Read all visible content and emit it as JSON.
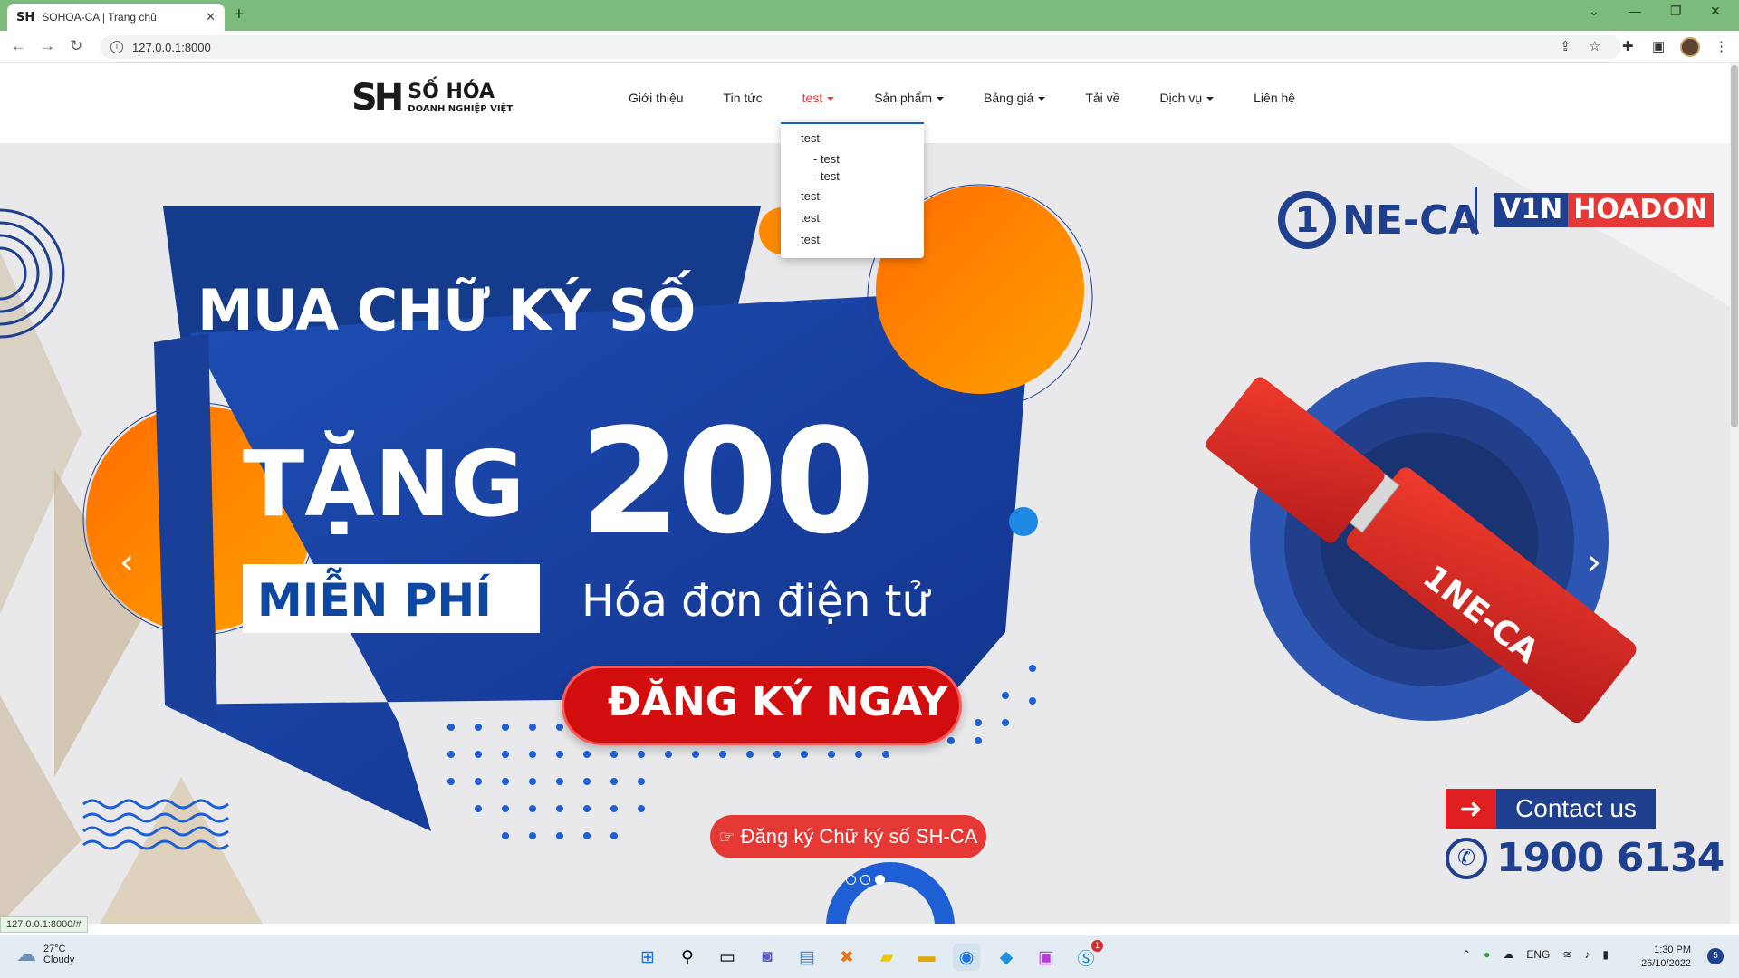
{
  "browser": {
    "tab_title": "SOHOA-CA | Trang chủ",
    "favicon": "SH",
    "new_tab": "+",
    "close": "✕",
    "url": "127.0.0.1:8000",
    "status_url": "127.0.0.1:8000/#"
  },
  "logo": {
    "mark": "SH",
    "title": "SỐ HÓA",
    "subtitle": "DOANH NGHIỆP VIỆT"
  },
  "nav": {
    "items": [
      {
        "label": "Giới thiệu"
      },
      {
        "label": "Tin tức"
      },
      {
        "label": "test"
      },
      {
        "label": "Sản phẩm"
      },
      {
        "label": "Bảng giá"
      },
      {
        "label": "Tải về"
      },
      {
        "label": "Dịch vụ"
      },
      {
        "label": "Liên hệ"
      }
    ],
    "active_color": "#e53935"
  },
  "dropdown": {
    "items": [
      {
        "label": "test"
      },
      {
        "label": "- test"
      },
      {
        "label": "- test"
      },
      {
        "label": "test"
      },
      {
        "label": "test"
      },
      {
        "label": "test"
      }
    ]
  },
  "banner": {
    "headline_1": "MUA CHỮ KÝ SỐ",
    "headline_2": "TẶNG",
    "headline_number": "200",
    "free_label": "MIỄN PHÍ",
    "invoice_label": "Hóa đơn điện tử",
    "register_label": "ĐĂNG KÝ NGAY",
    "brand_one": "NE-CA",
    "brand_one_digit": "1",
    "brand_vin": "V1N",
    "brand_hoadon": "HOADON",
    "usb_brand": "NE-CA",
    "contact_label": "Contact us",
    "hotline": "1900 6134",
    "cta_label": "Đăng ký Chữ ký số SH-CA",
    "brand_blue": "#1f3f8f",
    "brand_red": "#e02020"
  },
  "carousel": {
    "prev_icon": "‹",
    "next_icon": "›",
    "active_index": 2
  },
  "taskbar": {
    "temperature": "27°C",
    "condition": "Cloudy",
    "language": "ENG",
    "time": "1:30 PM",
    "date": "26/10/2022",
    "notification_count": "5",
    "badge_count": "1"
  }
}
